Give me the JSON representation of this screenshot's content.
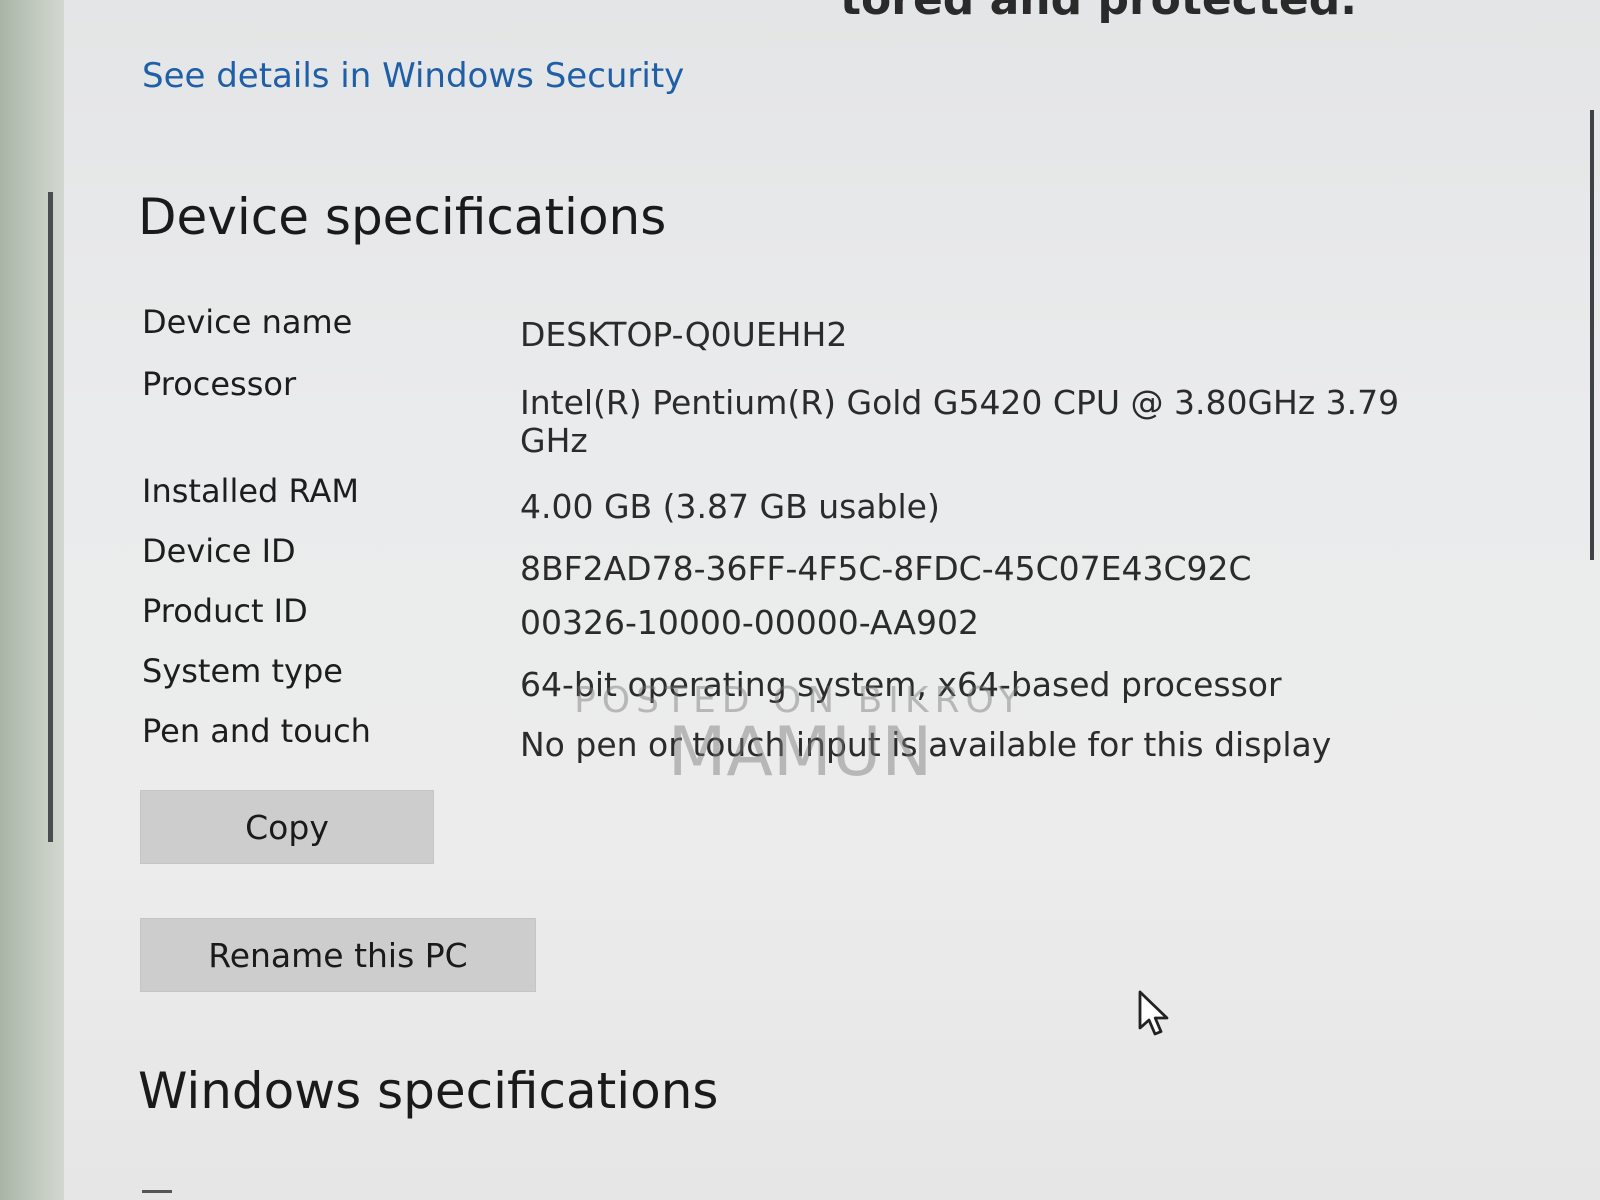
{
  "header": {
    "partial_heading": "tored and protected.",
    "security_link_label": "See details in Windows Security"
  },
  "device_specifications": {
    "title": "Device specifications",
    "rows": [
      {
        "label": "Device name",
        "value": "DESKTOP-Q0UEHH2"
      },
      {
        "label": "Processor",
        "value": "Intel(R) Pentium(R) Gold G5420 CPU @ 3.80GHz 3.79 GHz"
      },
      {
        "label": "Installed RAM",
        "value": "4.00 GB (3.87 GB usable)"
      },
      {
        "label": "Device ID",
        "value": "8BF2AD78-36FF-4F5C-8FDC-45C07E43C92C"
      },
      {
        "label": "Product ID",
        "value": "00326-10000-00000-AA902"
      },
      {
        "label": "System type",
        "value": "64-bit operating system, x64-based processor"
      },
      {
        "label": "Pen and touch",
        "value": "No pen or touch input is available for this display"
      }
    ],
    "copy_button_label": "Copy",
    "rename_button_label": "Rename this PC"
  },
  "windows_specifications": {
    "title": "Windows specifications"
  },
  "watermark": {
    "line1": "POSTED ON BIKROY",
    "line2": "MAMUN"
  },
  "icons": {
    "cursor": "mouse-pointer-icon"
  },
  "colors": {
    "link": "#1f5fa7",
    "button_bg": "#cccdcc",
    "panel_bg": "#eaebec"
  }
}
